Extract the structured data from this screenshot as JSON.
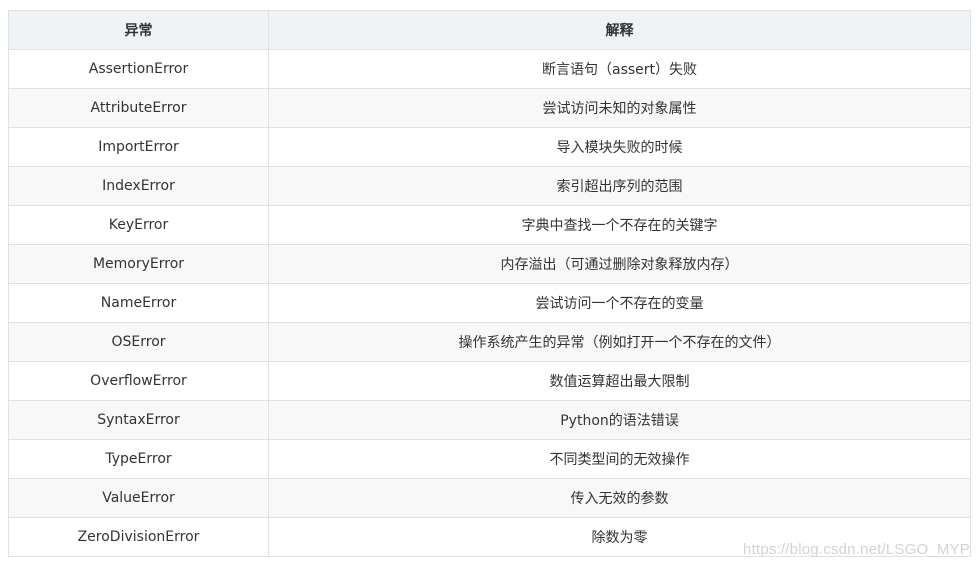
{
  "table": {
    "headers": [
      "异常",
      "解释"
    ],
    "rows": [
      {
        "name": "AssertionError",
        "desc": "断言语句（assert）失败"
      },
      {
        "name": "AttributeError",
        "desc": "尝试访问未知的对象属性"
      },
      {
        "name": "ImportError",
        "desc": "导入模块失败的时候"
      },
      {
        "name": "IndexError",
        "desc": "索引超出序列的范围"
      },
      {
        "name": "KeyError",
        "desc": "字典中查找一个不存在的关键字"
      },
      {
        "name": "MemoryError",
        "desc": "内存溢出（可通过删除对象释放内存）"
      },
      {
        "name": "NameError",
        "desc": "尝试访问一个不存在的变量"
      },
      {
        "name": "OSError",
        "desc": "操作系统产生的异常（例如打开一个不存在的文件）"
      },
      {
        "name": "OverflowError",
        "desc": "数值运算超出最大限制"
      },
      {
        "name": "SyntaxError",
        "desc": "Python的语法错误"
      },
      {
        "name": "TypeError",
        "desc": "不同类型间的无效操作"
      },
      {
        "name": "ValueError",
        "desc": "传入无效的参数"
      },
      {
        "name": "ZeroDivisionError",
        "desc": "除数为零"
      }
    ]
  },
  "watermark": "https://blog.csdn.net/LSGO_MYP",
  "colors": {
    "header_bg": "#eff3f5",
    "stripe_bg": "#f8f8f8",
    "border": "#dfe2e5",
    "text": "#333333"
  }
}
